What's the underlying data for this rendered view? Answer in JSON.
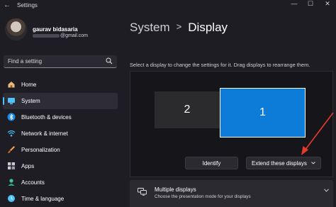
{
  "window": {
    "back_glyph": "←",
    "title": "Settings",
    "minimize_glyph": "—",
    "maximize_glyph": "☐",
    "close_glyph": "✕"
  },
  "user": {
    "name": "gaurav bidasaria",
    "email_suffix": "@gmail.com"
  },
  "search": {
    "placeholder": "Find a setting",
    "icon": "search-icon"
  },
  "nav": {
    "items": [
      {
        "label": "Home",
        "icon": "home-icon"
      },
      {
        "label": "System",
        "icon": "system-monitor-icon",
        "active": true
      },
      {
        "label": "Bluetooth & devices",
        "icon": "bluetooth-icon"
      },
      {
        "label": "Network & internet",
        "icon": "wifi-icon"
      },
      {
        "label": "Personalization",
        "icon": "paintbrush-icon"
      },
      {
        "label": "Apps",
        "icon": "apps-icon"
      },
      {
        "label": "Accounts",
        "icon": "account-icon"
      },
      {
        "label": "Time & language",
        "icon": "globe-clock-icon"
      }
    ]
  },
  "breadcrumb": {
    "parent": "System",
    "separator": ">",
    "current": "Display"
  },
  "display_arrangement": {
    "hint": "Select a display to change the settings for it. Drag displays to rearrange them.",
    "monitors": [
      {
        "number": "2",
        "selected": false
      },
      {
        "number": "1",
        "selected": true
      }
    ],
    "identify_label": "Identify",
    "mode_select_value": "Extend these displays"
  },
  "multiple_displays": {
    "title": "Multiple displays",
    "subtitle": "Choose the presentation mode for your displays",
    "icon": "multiple-displays-icon"
  },
  "colors": {
    "accent": "#4cc2ff",
    "selected_monitor": "#0d7cd9",
    "annotation_arrow": "#e8392d",
    "background": "#1f1d24"
  }
}
